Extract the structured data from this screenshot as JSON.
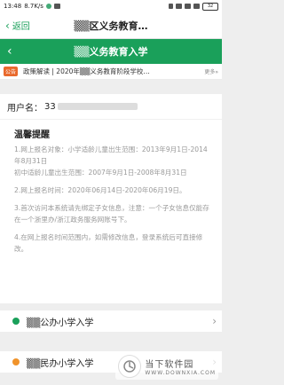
{
  "status_bar": {
    "time": "13:48",
    "speed": "8.7K/s",
    "battery": "32"
  },
  "nav": {
    "back_label": "返回",
    "title": "▒▒区义务教育…"
  },
  "header": {
    "title": "▒▒义务教育入学"
  },
  "notice": {
    "tag": "公告",
    "text": "政策解读 | 2020年▒▒义务教育阶段学校…",
    "more": "更多»"
  },
  "user": {
    "label": "用户名：",
    "value_prefix": "33"
  },
  "tips": {
    "title": "温馨提醒",
    "items": [
      "1.网上报名对象：小学适龄儿童出生范围：2013年9月1日-2014年8月31日",
      "初中适龄儿童出生范围：2007年9月1日-2008年8月31日",
      "2.网上报名时间：2020年06月14日-2020年06月19日。",
      "3.首次访问本系统请先绑定子女信息，注意：一个子女信息仅能存在一个浙里办/浙江政务服务网账号下。",
      "4.在网上报名时间范围内，如需修改信息，登录系统后可直接修改。"
    ]
  },
  "schools": [
    {
      "label": "▒▒公办小学入学",
      "dot_color": "#1aa05a"
    },
    {
      "label": "▒▒民办小学入学",
      "dot_color": "#f0932b"
    }
  ],
  "watermark": {
    "cn": "当下软件园",
    "en": "WWW.DOWNXIA.COM"
  },
  "colors": {
    "brand_green": "#1aa05a",
    "notice_orange": "#e9692c"
  }
}
